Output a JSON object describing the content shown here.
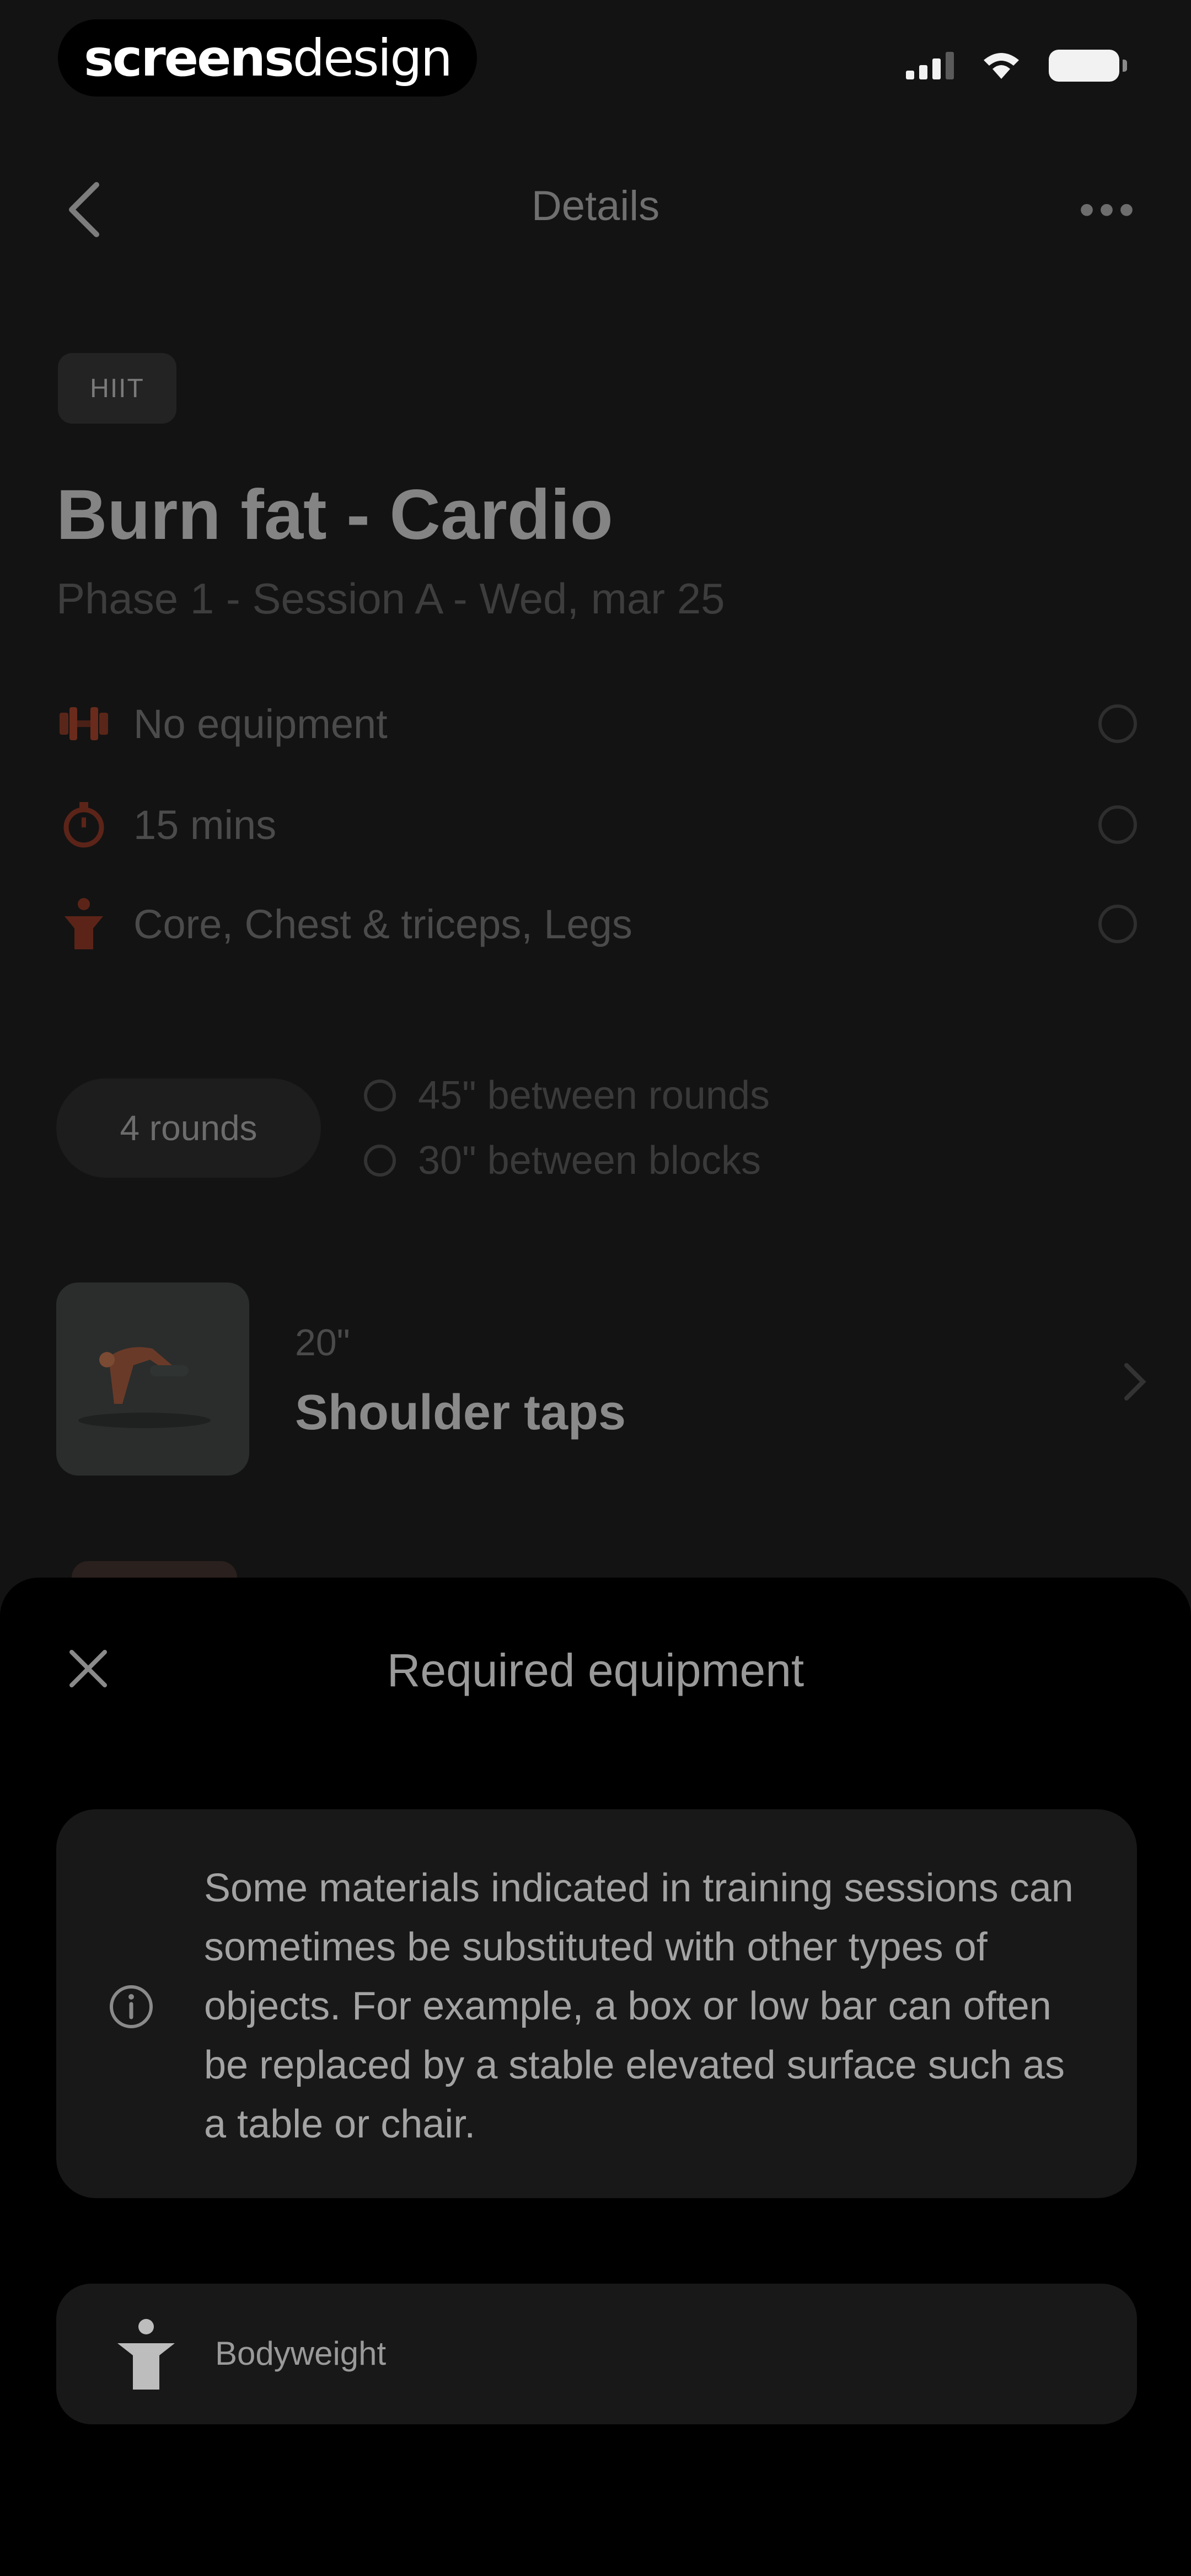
{
  "status_bar": {
    "brand": {
      "part1": "screens",
      "part2": "design"
    },
    "signal_icon": "cellular-signal-icon",
    "wifi_icon": "wifi-icon",
    "battery_icon": "battery-icon"
  },
  "header": {
    "back_icon": "chevron-left-icon",
    "title": "Details",
    "more_icon": "more-horizontal-icon"
  },
  "workout": {
    "tag": "HIIT",
    "title": "Burn fat - Cardio",
    "subtitle": "Phase 1 - Session A - Wed, mar 25",
    "info": [
      {
        "icon": "equipment-icon",
        "text": "No equipment"
      },
      {
        "icon": "timer-icon",
        "text": "15 mins"
      },
      {
        "icon": "body-muscle-icon",
        "text": "Core, Chest & triceps, Legs"
      }
    ],
    "rounds": "4 rounds",
    "rest": [
      {
        "icon": "clock-icon",
        "text": "45\" between rounds"
      },
      {
        "icon": "clock-icon",
        "text": "30\" between blocks"
      }
    ],
    "exercise": {
      "duration": "20\"",
      "name": "Shoulder taps"
    }
  },
  "sheet": {
    "close_icon": "close-icon",
    "title": "Required equipment",
    "info_icon": "info-icon",
    "info_text": "Some materials indicated in training sessions can sometimes be substituted with other types of objects. For example, a box or low bar can often be replaced by a stable elevated surface such as a table or chair.",
    "items": [
      {
        "icon": "bodyweight-icon",
        "label": "Bodyweight"
      }
    ]
  },
  "colors": {
    "background": "#131313",
    "sheet": "#000000",
    "card": "#181818",
    "accent": "#b13a22"
  }
}
